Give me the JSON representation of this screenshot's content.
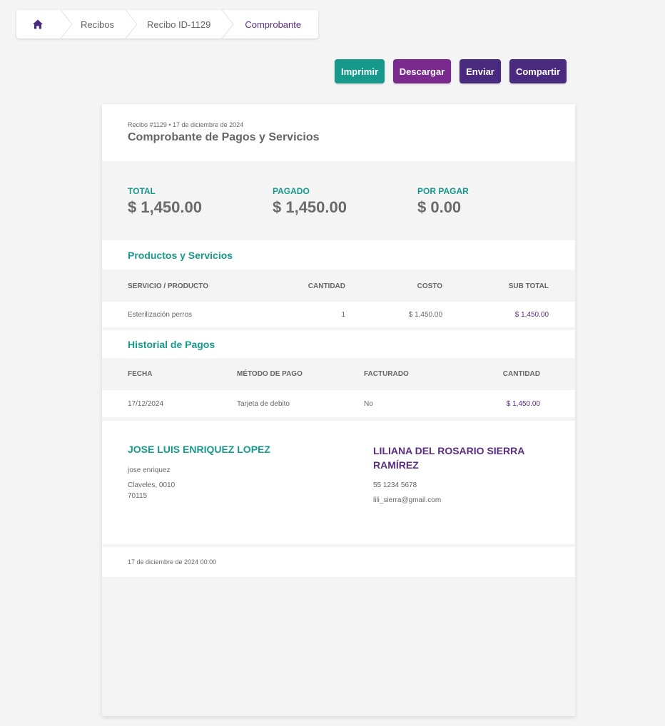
{
  "breadcrumb": {
    "home_icon": "home-icon",
    "items": [
      "Recibos",
      "Recibo ID-1129",
      "Comprobante"
    ]
  },
  "actions": {
    "print": "Imprimir",
    "download": "Descargar",
    "send": "Enviar",
    "share": "Compartir"
  },
  "colors": {
    "teal": "#17998c",
    "purple": "#7a2a8e",
    "dark_purple": "#4a2a7e"
  },
  "receipt": {
    "meta": "Recibo #1129 • 17 de diciembre de 2024",
    "title": "Comprobante de Pagos y Servicios"
  },
  "summary": {
    "total_label": "TOTAL",
    "total_value": "$ 1,450.00",
    "paid_label": "PAGADO",
    "paid_value": "$ 1,450.00",
    "due_label": "POR PAGAR",
    "due_value": "$ 0.00"
  },
  "products": {
    "section_title": "Productos y Servicios",
    "headers": [
      "SERVICIO / PRODUCTO",
      "CANTIDAD",
      "COSTO",
      "SUB TOTAL"
    ],
    "rows": [
      [
        "Esterilización perros",
        "1",
        "$ 1,450.00",
        "$ 1,450.00"
      ]
    ]
  },
  "payments": {
    "section_title": "Historial de Pagos",
    "headers": [
      "FECHA",
      "MÉTODO DE PAGO",
      "FACTURADO",
      "CANTIDAD"
    ],
    "rows": [
      [
        "17/12/2024",
        "Tarjeta de debito",
        "No",
        "$ 1,450.00"
      ]
    ]
  },
  "issuer": {
    "name": "JOSE LUIS ENRIQUEZ LOPEZ",
    "username": "jose enriquez",
    "address_line1": "Claveles, 0010",
    "address_line2": "70115"
  },
  "client": {
    "name": "LILIANA DEL ROSARIO SIERRA RAMÍREZ",
    "phone": "55 1234 5678",
    "email": "lili_sierra@gmail.com"
  },
  "footer": {
    "date": "17 de diciembre de 2024 00:00"
  }
}
